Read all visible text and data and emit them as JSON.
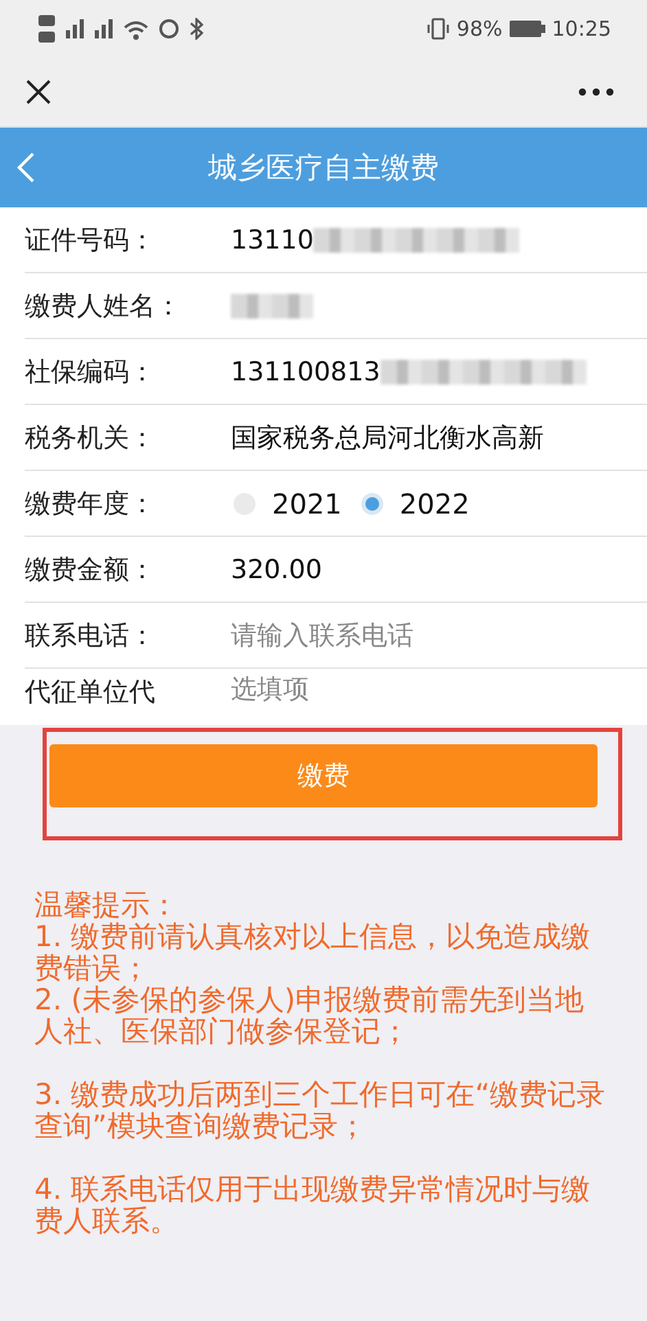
{
  "status_bar": {
    "battery": "98%",
    "time": "10:25"
  },
  "title": "城乡医疗自主缴费",
  "rows": [
    {
      "kind": "text",
      "label": "证件号码：",
      "value": "13110",
      "redacted": true
    },
    {
      "kind": "text",
      "label": "缴费人姓名：",
      "redacted": true
    },
    {
      "kind": "text",
      "label": "社保编码：",
      "value": "131100813",
      "redacted": true
    },
    {
      "kind": "text",
      "label": "税务机关：",
      "value": "国家税务总局河北衡水高新"
    },
    {
      "kind": "radio",
      "label": "缴费年度：",
      "options": [
        {
          "label": "2021",
          "selected": false
        },
        {
          "label": "2022",
          "selected": true
        }
      ]
    },
    {
      "kind": "text",
      "label": "缴费金额：",
      "value": "320.00"
    },
    {
      "kind": "input",
      "label": "联系电话：",
      "placeholder": "请输入联系电话"
    },
    {
      "kind": "input",
      "label": "代征单位代",
      "placeholder": "选填项"
    }
  ],
  "pay_button": "缴费",
  "notes": {
    "title": "温馨提示：",
    "items": [
      "1. 缴费前请认真核对以上信息，以免造成缴费错误；",
      "2. (未参保的参保人)申报缴费前需先到当地人社、医保部门做参保登记；",
      "3. 缴费成功后两到三个工作日可在“缴费记录查询”模块查询缴费记录；",
      "4. 联系电话仅用于出现缴费异常情况时与缴费人联系。"
    ]
  }
}
